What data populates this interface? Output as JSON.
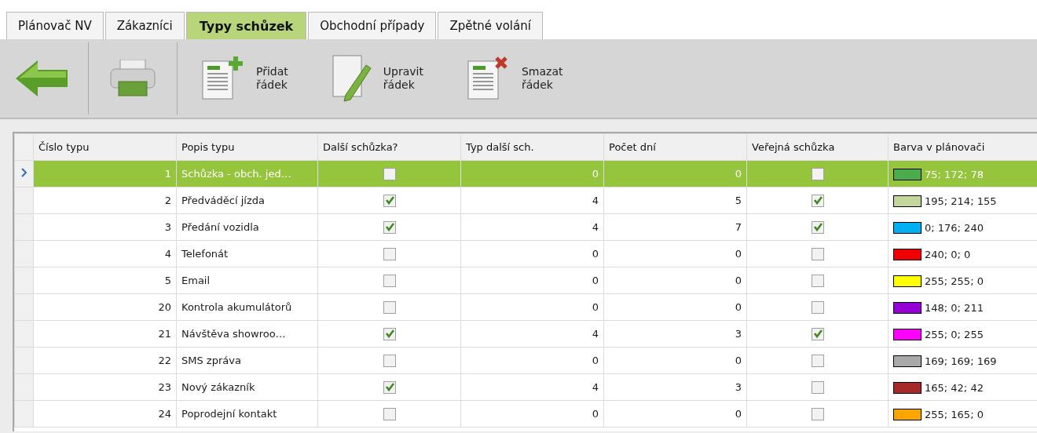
{
  "tabs": [
    {
      "label": "Plánovač NV",
      "selected": false
    },
    {
      "label": "Zákazníci",
      "selected": false
    },
    {
      "label": "Typy schůzek",
      "selected": true
    },
    {
      "label": "Obchodní případy",
      "selected": false
    },
    {
      "label": "Zpětné volání",
      "selected": false
    }
  ],
  "toolbar": [
    {
      "kind": "back"
    },
    {
      "kind": "print"
    },
    {
      "kind": "add",
      "label": [
        "Přidat",
        "řádek"
      ]
    },
    {
      "kind": "edit",
      "label": [
        "Upravit",
        "řádek"
      ]
    },
    {
      "kind": "delete",
      "label": [
        "Smazat",
        "řádek"
      ]
    }
  ],
  "table": {
    "columns": [
      "Číslo typu",
      "Popis typu",
      "Další schůzka?",
      "Typ další sch.",
      "Počet dní",
      "Veřejná schůzka",
      "Barva v plánovači"
    ],
    "rows": [
      {
        "selected": true,
        "number": "1",
        "description": "Schůzka - obch. jed…",
        "next_meeting": false,
        "next_type": "0",
        "days": "0",
        "public": false,
        "color": "#4bac4e",
        "color_text": "75; 172; 78"
      },
      {
        "selected": false,
        "number": "2",
        "description": "Předváděcí jízda",
        "next_meeting": true,
        "next_type": "4",
        "days": "5",
        "public": true,
        "color": "#c3d69b",
        "color_text": "195; 214; 155"
      },
      {
        "selected": false,
        "number": "3",
        "description": "Předání vozidla",
        "next_meeting": true,
        "next_type": "4",
        "days": "7",
        "public": true,
        "color": "#00b0f0",
        "color_text": "0; 176; 240"
      },
      {
        "selected": false,
        "number": "4",
        "description": "Telefonát",
        "next_meeting": false,
        "next_type": "0",
        "days": "0",
        "public": false,
        "color": "#f00000",
        "color_text": "240; 0; 0"
      },
      {
        "selected": false,
        "number": "5",
        "description": "Email",
        "next_meeting": false,
        "next_type": "0",
        "days": "0",
        "public": false,
        "color": "#ffff00",
        "color_text": "255; 255; 0"
      },
      {
        "selected": false,
        "number": "20",
        "description": "Kontrola akumulátorů",
        "next_meeting": false,
        "next_type": "0",
        "days": "0",
        "public": false,
        "color": "#9400d3",
        "color_text": "148; 0; 211"
      },
      {
        "selected": false,
        "number": "21",
        "description": "Návštěva showroo…",
        "next_meeting": true,
        "next_type": "4",
        "days": "3",
        "public": true,
        "color": "#ff00ff",
        "color_text": "255; 0; 255"
      },
      {
        "selected": false,
        "number": "22",
        "description": "SMS zpráva",
        "next_meeting": false,
        "next_type": "0",
        "days": "0",
        "public": false,
        "color": "#a9a9a9",
        "color_text": "169; 169; 169"
      },
      {
        "selected": false,
        "number": "23",
        "description": "Nový zákazník",
        "next_meeting": true,
        "next_type": "4",
        "days": "3",
        "public": false,
        "color": "#a52a2a",
        "color_text": "165; 42; 42"
      },
      {
        "selected": false,
        "number": "24",
        "description": "Poprodejní kontakt",
        "next_meeting": false,
        "next_type": "0",
        "days": "0",
        "public": false,
        "color": "#ffa500",
        "color_text": "255; 165; 0"
      }
    ]
  }
}
